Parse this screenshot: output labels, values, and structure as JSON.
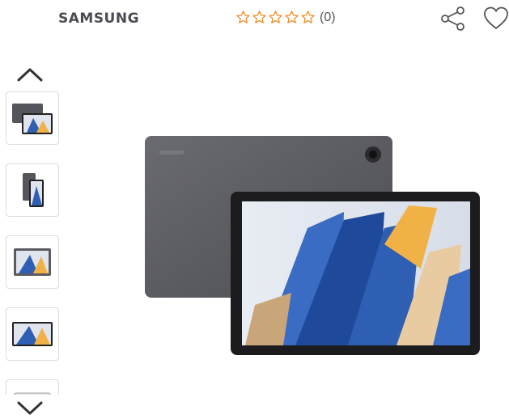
{
  "header": {
    "brand_logo_text": "SAMSUNG",
    "rating": {
      "stars_total": 5,
      "stars_filled": 0,
      "count_label": "(0)"
    },
    "icons": [
      "share-icon",
      "heart-icon"
    ]
  },
  "gallery": {
    "nav_icons": [
      "chevron-up-icon",
      "chevron-down-icon"
    ],
    "thumbnails_visible": 5,
    "selected_index": 0
  },
  "colors": {
    "star_orange": "#f08a24",
    "icon_gray": "#555555",
    "tablet_body": "#5a5b60",
    "wallpaper_blue": "#2f5fb3",
    "wallpaper_gold": "#f0b247"
  }
}
